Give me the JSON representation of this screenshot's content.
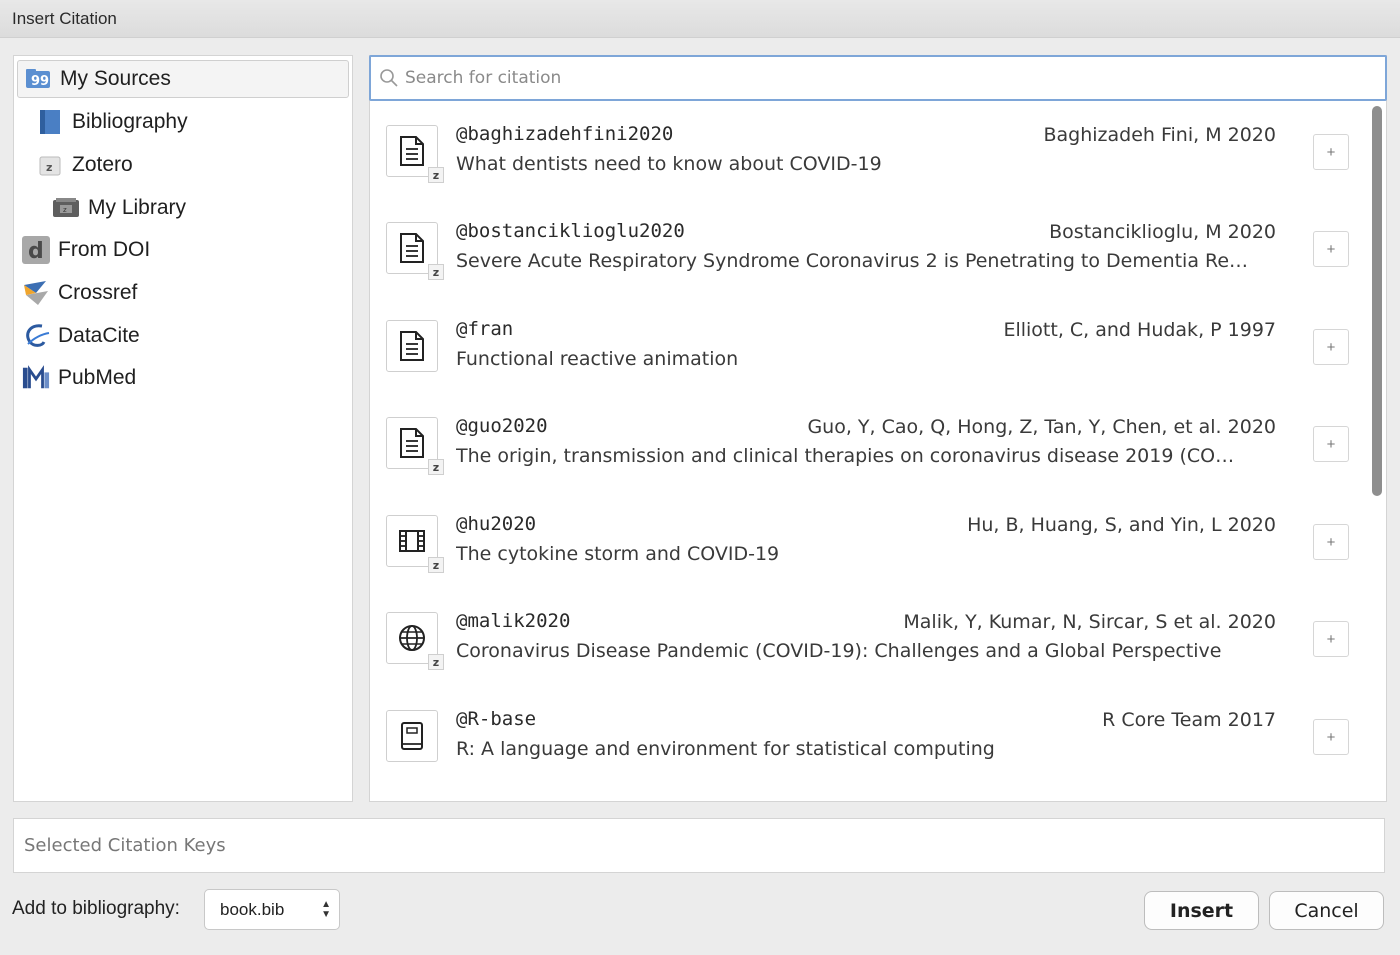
{
  "window": {
    "title": "Insert Citation"
  },
  "sidebar": {
    "items": [
      {
        "label": "My Sources",
        "icon": "quote-folder-icon"
      },
      {
        "label": "Bibliography",
        "icon": "book-icon"
      },
      {
        "label": "Zotero",
        "icon": "zotero-icon"
      },
      {
        "label": "My Library",
        "icon": "library-drawer-icon"
      },
      {
        "label": "From DOI",
        "icon": "doi-icon"
      },
      {
        "label": "Crossref",
        "icon": "crossref-icon"
      },
      {
        "label": "DataCite",
        "icon": "datacite-icon"
      },
      {
        "label": "PubMed",
        "icon": "pubmed-icon"
      }
    ]
  },
  "search": {
    "placeholder": "Search for citation",
    "value": ""
  },
  "citations": [
    {
      "key": "@baghizadehfini2020",
      "authors": "Baghizadeh Fini, M 2020",
      "title": "What dentists need to know about COVID-19",
      "type_icon": "document-icon",
      "zotero": true
    },
    {
      "key": "@bostanciklioglu2020",
      "authors": "Bostanciklioglu, M 2020",
      "title": "Severe Acute Respiratory Syndrome Coronavirus 2 is Penetrating to Dementia Re…",
      "type_icon": "document-icon",
      "zotero": true
    },
    {
      "key": "@fran",
      "authors": "Elliott, C, and Hudak, P 1997",
      "title": "Functional reactive animation",
      "type_icon": "document-icon",
      "zotero": false
    },
    {
      "key": "@guo2020",
      "authors": "Guo, Y, Cao, Q, Hong, Z, Tan, Y, Chen, et al. 2020",
      "title": "The origin, transmission and clinical therapies on coronavirus disease 2019 (CO…",
      "type_icon": "document-icon",
      "zotero": true
    },
    {
      "key": "@hu2020",
      "authors": "Hu, B, Huang, S, and Yin, L 2020",
      "title": "The cytokine storm and COVID-19",
      "type_icon": "film-icon",
      "zotero": true
    },
    {
      "key": "@malik2020",
      "authors": "Malik, Y, Kumar, N, Sircar, S et al. 2020",
      "title": "Coronavirus Disease Pandemic (COVID-19): Challenges and a Global Perspective",
      "type_icon": "globe-icon",
      "zotero": true
    },
    {
      "key": "@R-base",
      "authors": "R Core Team 2017",
      "title": "R: A language and environment for statistical computing",
      "type_icon": "book-entry-icon",
      "zotero": false
    }
  ],
  "add_button_label": "+",
  "zotero_badge": "z",
  "selected_keys": {
    "placeholder": "Selected Citation Keys"
  },
  "footer": {
    "add_to_bib_label": "Add to bibliography:",
    "bib_file": "book.bib",
    "insert_label": "Insert",
    "cancel_label": "Cancel"
  }
}
